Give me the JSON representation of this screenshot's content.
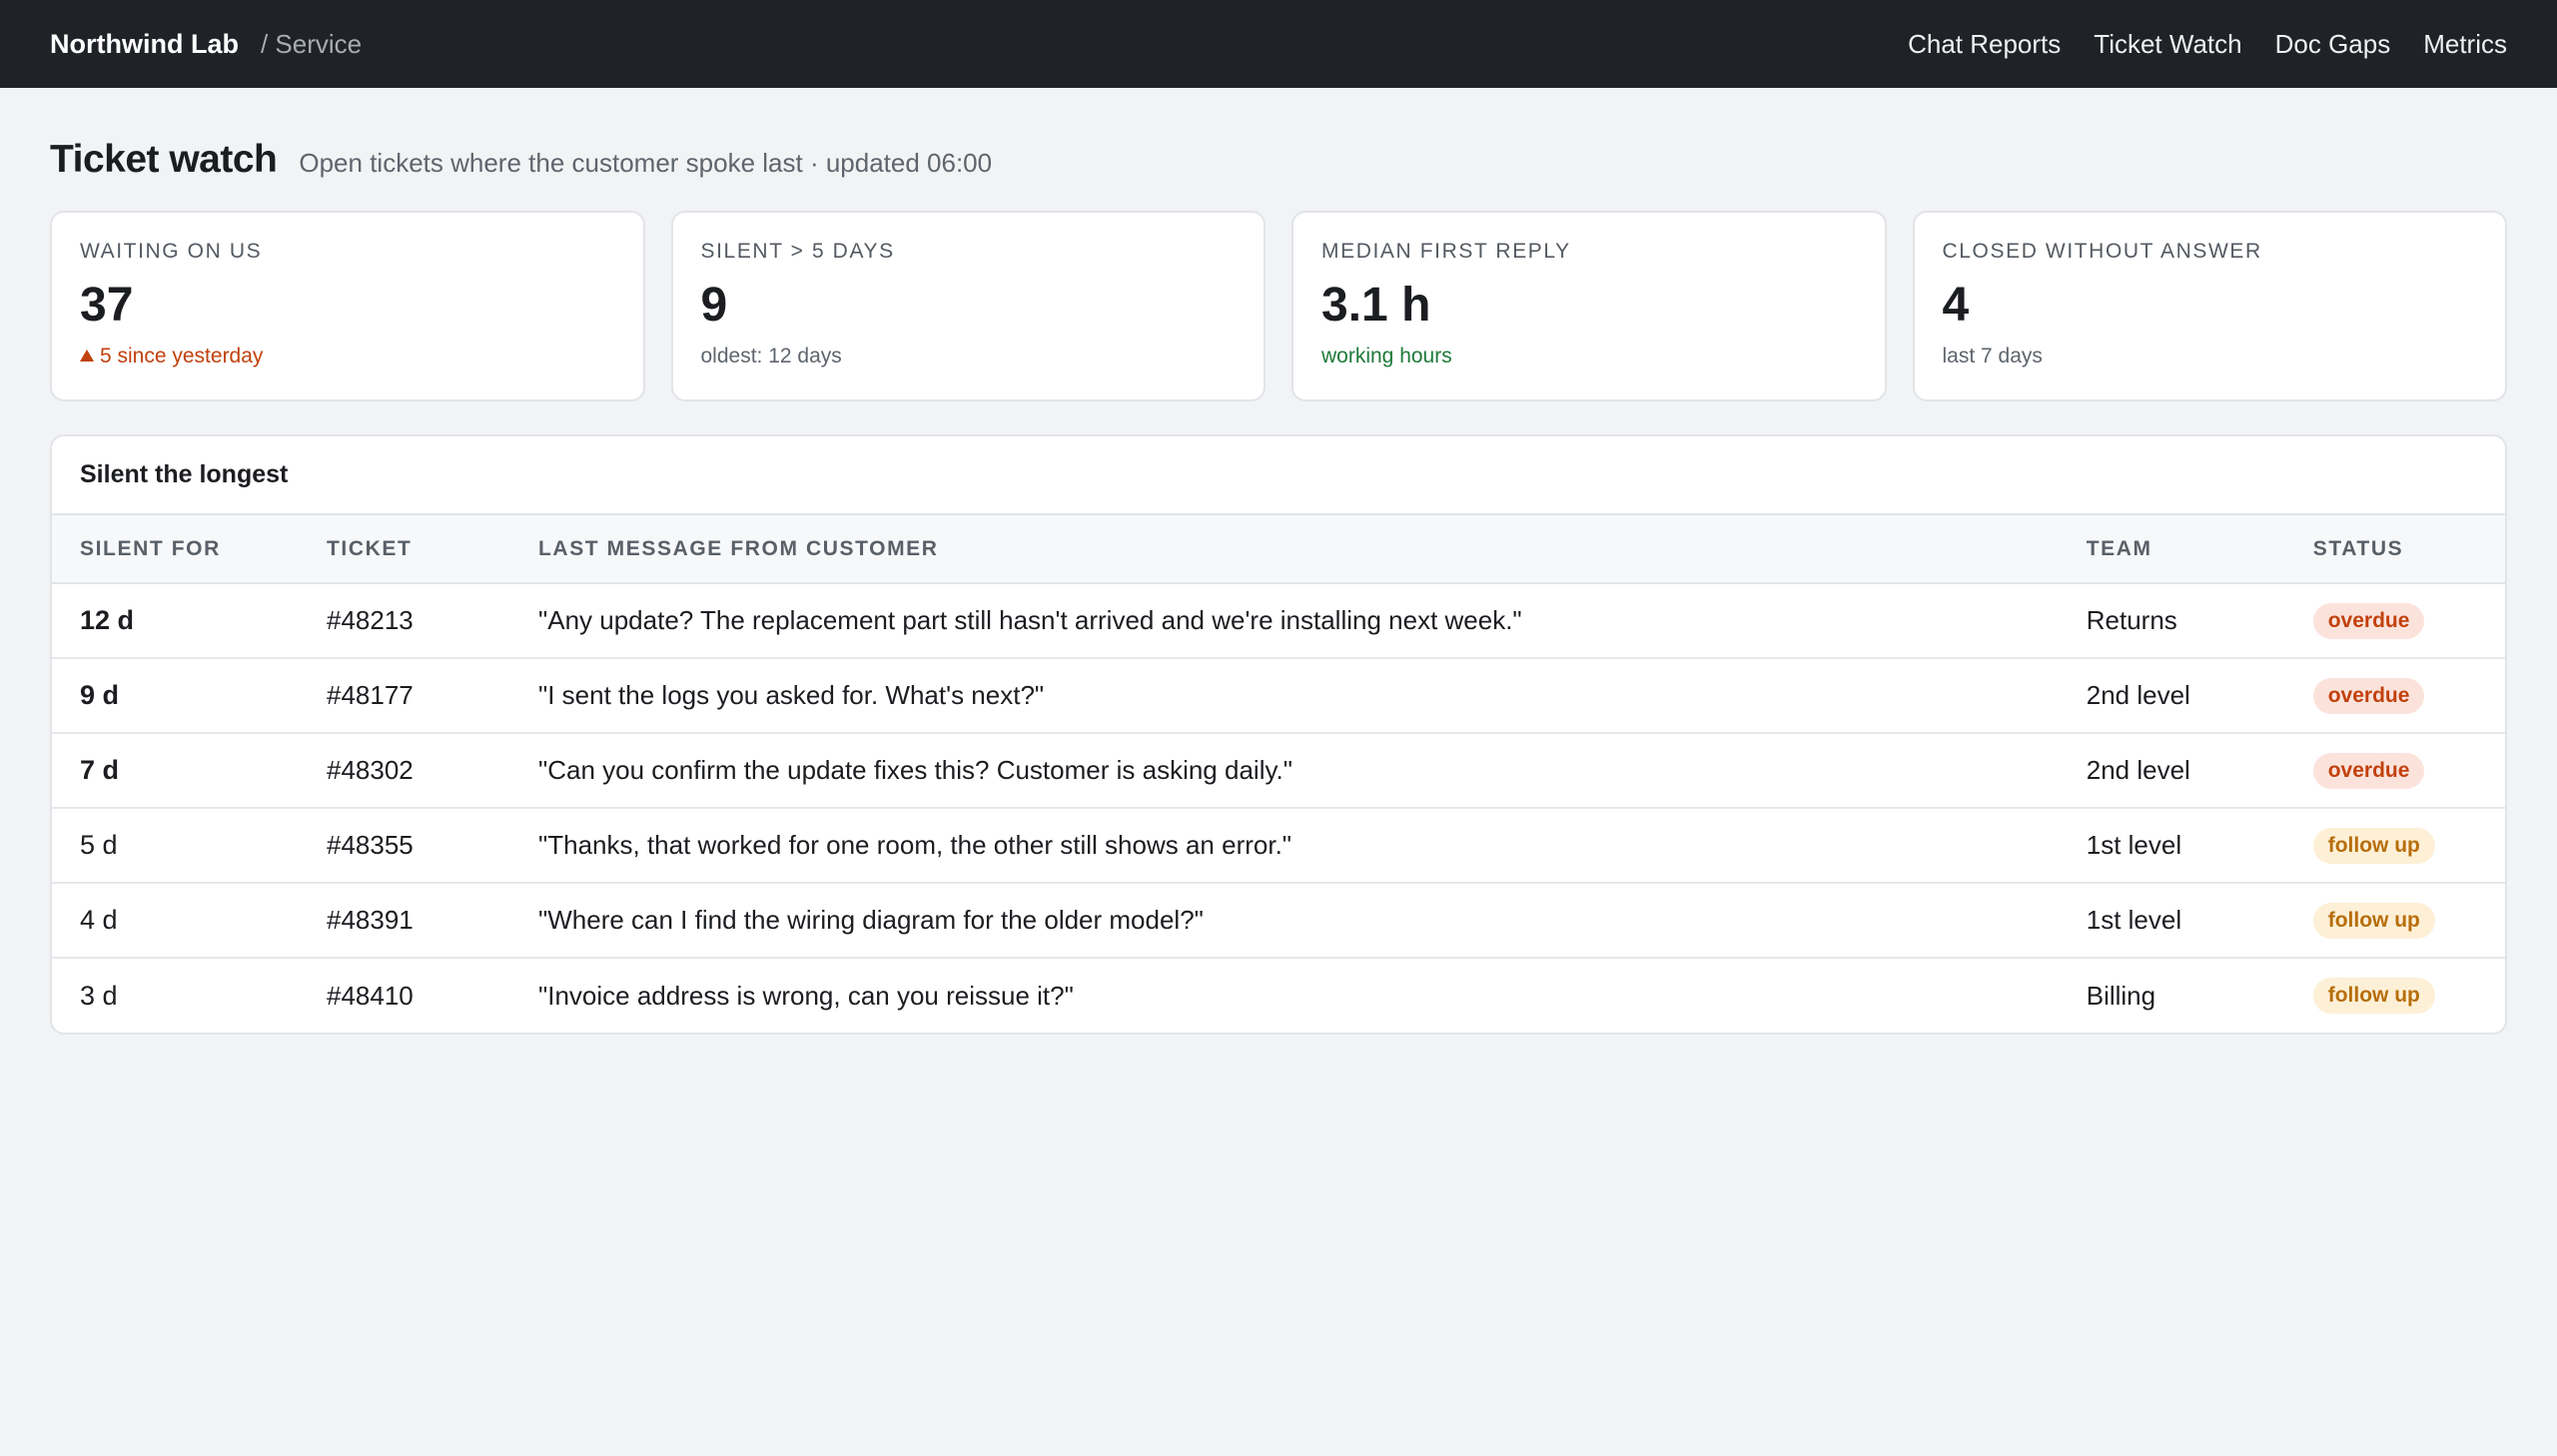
{
  "header": {
    "brand": "Northwind Lab",
    "breadcrumb": "/ Service",
    "nav": [
      "Chat Reports",
      "Ticket Watch",
      "Doc Gaps",
      "Metrics"
    ]
  },
  "page": {
    "title": "Ticket watch",
    "subtitle": "Open tickets where the customer spoke last · updated 06:00"
  },
  "cards": [
    {
      "label": "Waiting on us",
      "value": "37",
      "note": "5 since yesterday",
      "tone": "warn"
    },
    {
      "label": "Silent > 5 days",
      "value": "9",
      "note": "oldest: 12 days",
      "tone": "muted"
    },
    {
      "label": "Median first reply",
      "value": "3.1 h",
      "note": "working hours",
      "tone": "good"
    },
    {
      "label": "Closed without answer",
      "value": "4",
      "note": "last 7 days",
      "tone": "muted"
    }
  ],
  "panel": {
    "title": "Silent the longest",
    "columns": [
      "Silent for",
      "Ticket",
      "Last message from customer",
      "Team",
      "Status"
    ],
    "rows": [
      {
        "silent": "12 d",
        "ticket": "#48213",
        "message": "\"Any update? The replacement part still hasn't arrived and we're installing next week.\"",
        "team": "Returns",
        "status": "overdue"
      },
      {
        "silent": "9 d",
        "ticket": "#48177",
        "message": "\"I sent the logs you asked for. What's next?\"",
        "team": "2nd level",
        "status": "overdue"
      },
      {
        "silent": "7 d",
        "ticket": "#48302",
        "message": "\"Can you confirm the update fixes this? Customer is asking daily.\"",
        "team": "2nd level",
        "status": "overdue"
      },
      {
        "silent": "5 d",
        "ticket": "#48355",
        "message": "\"Thanks, that worked for one room, the other still shows an error.\"",
        "team": "1st level",
        "status": "follow up"
      },
      {
        "silent": "4 d",
        "ticket": "#48391",
        "message": "\"Where can I find the wiring diagram for the older model?\"",
        "team": "1st level",
        "status": "follow up"
      },
      {
        "silent": "3 d",
        "ticket": "#48410",
        "message": "\"Invoice address is wrong, can you reissue it?\"",
        "team": "Billing",
        "status": "follow up"
      }
    ]
  },
  "colors": {
    "overdue": "#c2410c",
    "follow_up": "#b76e0b",
    "good": "#1f7a3a",
    "topbar": "#1f2226"
  }
}
